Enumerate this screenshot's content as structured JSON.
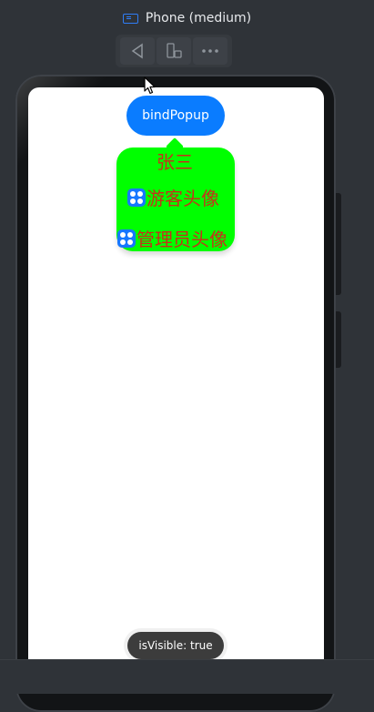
{
  "device": {
    "title": "Phone (medium)",
    "icon": "phone-device-icon",
    "accent": "#2f7df6"
  },
  "toolbar": {
    "items": [
      "back-icon",
      "rotate-device-icon",
      "more-icon"
    ]
  },
  "app": {
    "bind_button_label": "bindPopup",
    "bind_button_color": "#0a7cff",
    "popup": {
      "background": "#00ff00",
      "text_color": "#c7301a",
      "name": "张三",
      "rows": [
        {
          "icon": "app-grid-icon",
          "label": "游客头像"
        },
        {
          "icon": "app-grid-icon",
          "label": "管理员头像"
        }
      ]
    },
    "toast": "isVisible: true"
  }
}
